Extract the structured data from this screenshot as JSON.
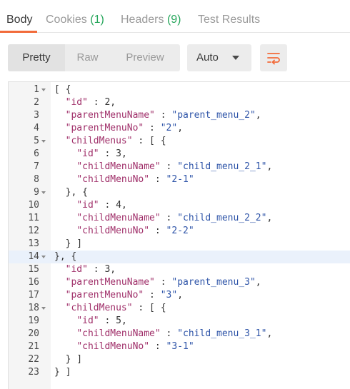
{
  "tabs": {
    "body": "Body",
    "cookies": "Cookies",
    "cookies_count": "(1)",
    "headers": "Headers",
    "headers_count": "(9)",
    "test_results": "Test Results"
  },
  "toolbar": {
    "pretty": "Pretty",
    "raw": "Raw",
    "preview": "Preview",
    "format_select": "Auto",
    "wrap_icon": "wrap-lines-icon"
  },
  "colors": {
    "accent": "#f26b3a",
    "count_green": "#26a65b",
    "json_key": "#a0306a",
    "json_string": "#2e54a8",
    "highlight_line": "#eaf1fb"
  },
  "code": {
    "lines": [
      {
        "n": "1",
        "t": "[ {"
      },
      {
        "n": "2",
        "t": "  \"id\" : 2,"
      },
      {
        "n": "3",
        "t": "  \"parentMenuName\" : \"parent_menu_2\","
      },
      {
        "n": "4",
        "t": "  \"parentMenuNo\" : \"2\","
      },
      {
        "n": "5",
        "t": "  \"childMenus\" : [ {"
      },
      {
        "n": "6",
        "t": "    \"id\" : 3,"
      },
      {
        "n": "7",
        "t": "    \"childMenuName\" : \"child_menu_2_1\","
      },
      {
        "n": "8",
        "t": "    \"childMenuNo\" : \"2-1\""
      },
      {
        "n": "9",
        "t": "  }, {"
      },
      {
        "n": "10",
        "t": "    \"id\" : 4,"
      },
      {
        "n": "11",
        "t": "    \"childMenuName\" : \"child_menu_2_2\","
      },
      {
        "n": "12",
        "t": "    \"childMenuNo\" : \"2-2\""
      },
      {
        "n": "13",
        "t": "  } ]"
      },
      {
        "n": "14",
        "t": "}, {"
      },
      {
        "n": "15",
        "t": "  \"id\" : 3,"
      },
      {
        "n": "16",
        "t": "  \"parentMenuName\" : \"parent_menu_3\","
      },
      {
        "n": "17",
        "t": "  \"parentMenuNo\" : \"3\","
      },
      {
        "n": "18",
        "t": "  \"childMenus\" : [ {"
      },
      {
        "n": "19",
        "t": "    \"id\" : 5,"
      },
      {
        "n": "20",
        "t": "    \"childMenuName\" : \"child_menu_3_1\","
      },
      {
        "n": "21",
        "t": "    \"childMenuNo\" : \"3-1\""
      },
      {
        "n": "22",
        "t": "  } ]"
      },
      {
        "n": "23",
        "t": "} ]"
      }
    ]
  }
}
